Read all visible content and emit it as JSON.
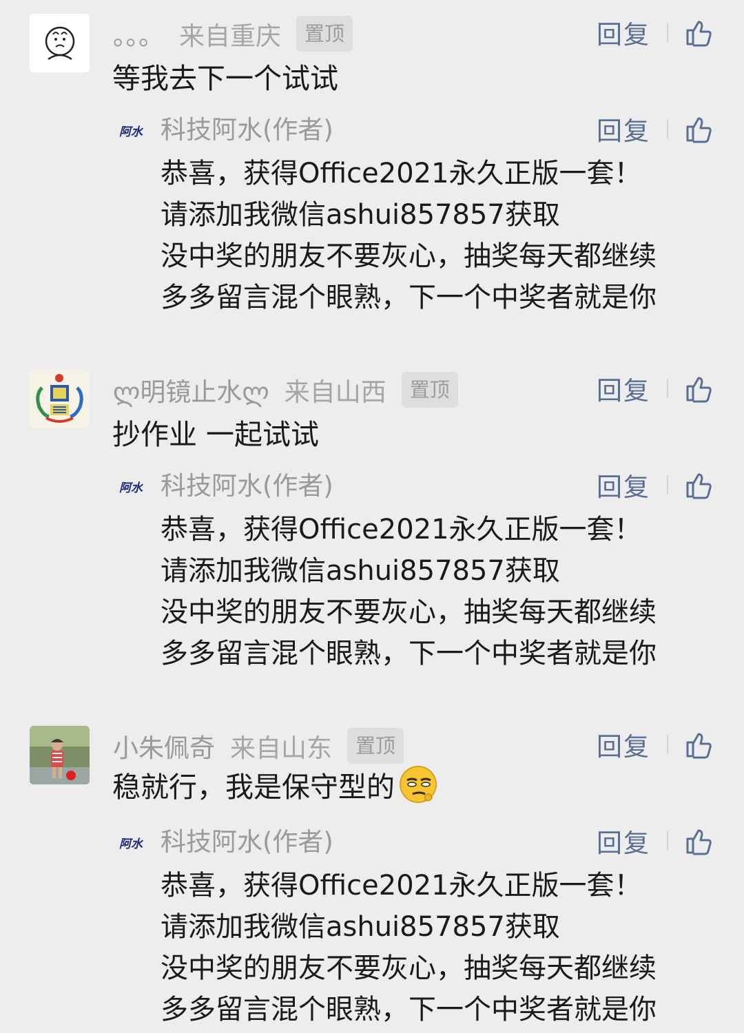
{
  "labels": {
    "reply": "回复",
    "pinned": "置顶"
  },
  "author_reply": {
    "nickname": "科技阿水(作者)",
    "logo_text": "阿水",
    "lines": [
      "恭喜，获得Office2021永久正版一套！",
      "请添加我微信ashui857857获取",
      "没中奖的朋友不要灰心，抽奖每天都继续",
      "多多留言混个眼熟，下一个中奖者就是你"
    ]
  },
  "comments": [
    {
      "nickname": "。。。",
      "location": "来自重庆",
      "text": "等我去下一个试试"
    },
    {
      "nickname": "ლ明镜止水ლ",
      "location": "来自山西",
      "text": "抄作业 一起试试"
    },
    {
      "nickname": "小朱佩奇",
      "location": "来自山东",
      "text": "稳就行，我是保守型的"
    }
  ],
  "colors": {
    "background": "#ededed",
    "reply_link": "#5a6e92",
    "meta_text": "#9a9a9a",
    "body_text": "#1a1a1a"
  }
}
